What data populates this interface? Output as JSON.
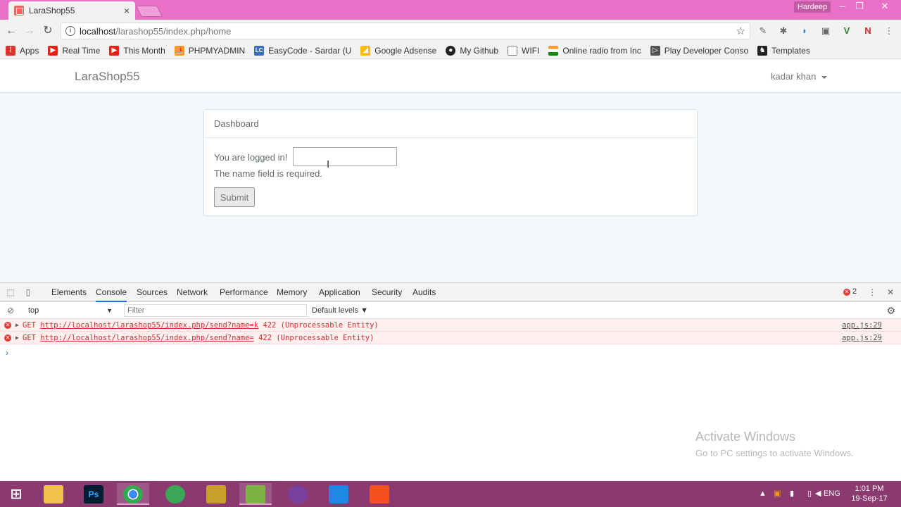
{
  "browser": {
    "tab_title": "LaraShop55",
    "tab_close": "×",
    "user_badge": "Hardeep",
    "url_host": "localhost",
    "url_path": "/larashop55/index.php/home"
  },
  "bookmarks": [
    {
      "label": "Apps",
      "icon": "apps-grid-icon",
      "color": "#d9362f"
    },
    {
      "label": "Real Time",
      "icon": "youtube-icon",
      "color": "#e62117"
    },
    {
      "label": "This Month",
      "icon": "youtube-icon",
      "color": "#e62117"
    },
    {
      "label": "PHPMYADMIN",
      "icon": "phpmyadmin-icon",
      "color": "#f59a23"
    },
    {
      "label": "EasyCode - Sardar (U",
      "icon": "lc-icon",
      "color": "#3a6fb5"
    },
    {
      "label": "Google Adsense",
      "icon": "adsense-icon",
      "color": "#fbbc05"
    },
    {
      "label": "My Github",
      "icon": "github-icon",
      "color": "#222222"
    },
    {
      "label": "WIFI",
      "icon": "page-icon",
      "color": "#888888"
    },
    {
      "label": "Online radio from Inc",
      "icon": "india-flag-icon",
      "color": "#ff9933"
    },
    {
      "label": "Play Developer Conso",
      "icon": "play-icon",
      "color": "#555555"
    },
    {
      "label": "Templates",
      "icon": "templates-icon",
      "color": "#222222"
    }
  ],
  "app": {
    "brand": "LaraShop55",
    "user_name": "kadar khan",
    "panel_title": "Dashboard",
    "logged_in_text": "You are logged in!",
    "name_value": "",
    "error_text": "The name field is required.",
    "submit_label": "Submit"
  },
  "devtools": {
    "tabs": [
      "Elements",
      "Console",
      "Sources",
      "Network",
      "Performance",
      "Memory",
      "Application",
      "Security",
      "Audits"
    ],
    "active_tab": "Console",
    "error_count": "2",
    "context": "top",
    "filter_placeholder": "Filter",
    "levels": "Default levels",
    "messages": [
      {
        "method": "GET",
        "url": "http://localhost/larashop55/index.php/send?name=k",
        "status": "422 (Unprocessable Entity)",
        "source": "app.js:29"
      },
      {
        "method": "GET",
        "url": "http://localhost/larashop55/index.php/send?name=",
        "status": "422 (Unprocessable Entity)",
        "source": "app.js:29"
      }
    ],
    "prompt": "›"
  },
  "watermark": {
    "title": "Activate Windows",
    "subtitle": "Go to PC settings to activate Windows."
  },
  "taskbar": {
    "language": "ENG",
    "time": "1:01 PM",
    "date": "19-Sep-17",
    "apps": [
      {
        "name": "file-explorer-icon",
        "color": "#f0c24b",
        "label": ""
      },
      {
        "name": "photoshop-icon",
        "color": "#001d34",
        "label": "Ps"
      },
      {
        "name": "chrome-icon",
        "color": "#4caf50",
        "label": ""
      },
      {
        "name": "globe-app-icon",
        "color": "#3aa757",
        "label": ""
      },
      {
        "name": "pineapple-app-icon",
        "color": "#c8a02a",
        "label": ""
      },
      {
        "name": "sublime-notepad-icon",
        "color": "#7cb342",
        "label": ""
      },
      {
        "name": "hamster-app-icon",
        "color": "#7b3fa0",
        "label": ""
      },
      {
        "name": "vscode-icon",
        "color": "#1e88e5",
        "label": ""
      },
      {
        "name": "xampp-icon",
        "color": "#f4511e",
        "label": ""
      }
    ]
  }
}
